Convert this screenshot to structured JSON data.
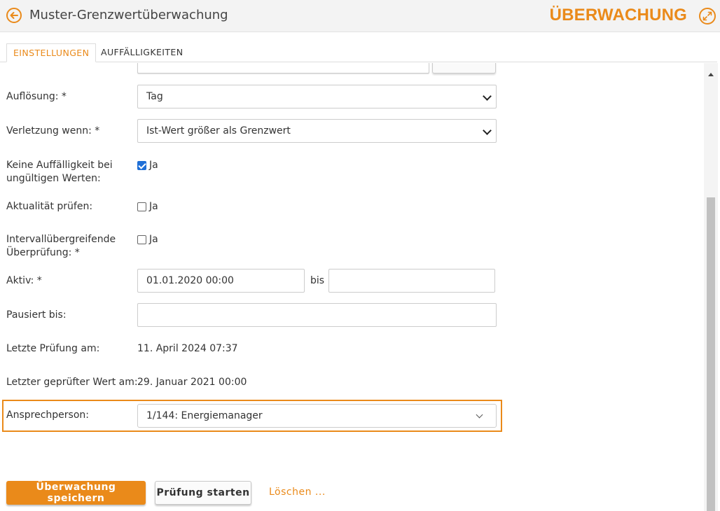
{
  "header": {
    "title": "Muster-Grenzwertüberwachung",
    "brand": "ÜBERWACHUNG"
  },
  "tabs": [
    {
      "label": "EINSTELLUNGEN",
      "active": true
    },
    {
      "label": "AUFFÄLLIGKEITEN",
      "active": false
    }
  ],
  "form": {
    "aufloesung": {
      "label": "Auflösung: *",
      "value": "Tag"
    },
    "verletzung": {
      "label": "Verletzung wenn: *",
      "value": "Ist-Wert größer als Grenzwert"
    },
    "keine_auffaelligkeit": {
      "label_line1": "Keine Auffälligkeit bei",
      "label_line2": "ungültigen Werten:",
      "checkbox_label": "Ja",
      "checked": true
    },
    "aktualitaet": {
      "label": "Aktualität prüfen:",
      "checkbox_label": "Ja",
      "checked": false
    },
    "intervall": {
      "label_line1": "Intervallübergreifende",
      "label_line2": "Überprüfung: *",
      "checkbox_label": "Ja",
      "checked": false
    },
    "aktiv": {
      "label": "Aktiv: *",
      "from": "01.01.2020 00:00",
      "separator": "bis",
      "to": ""
    },
    "pausiert": {
      "label": "Pausiert bis:",
      "value": ""
    },
    "letzte_pruefung": {
      "label": "Letzte Prüfung am:",
      "value": "11. April 2024 07:37"
    },
    "letzter_wert": {
      "label": "Letzter geprüfter Wert am:",
      "value": "29. Januar 2021 00:00"
    },
    "ansprechperson": {
      "label": "Ansprechperson:",
      "value": "1/144: Energiemanager"
    }
  },
  "actions": {
    "save_label": "Überwachung speichern",
    "start_label": "Prüfung starten",
    "delete_label": "Löschen ..."
  },
  "colors": {
    "accent": "#ea8a1a",
    "checkbox_checked": "#1f6fd6",
    "highlight_border": "#ea8a1a"
  },
  "icons": {
    "back": "arrow-left-circle-icon",
    "expand": "expand-arrows-icon"
  }
}
